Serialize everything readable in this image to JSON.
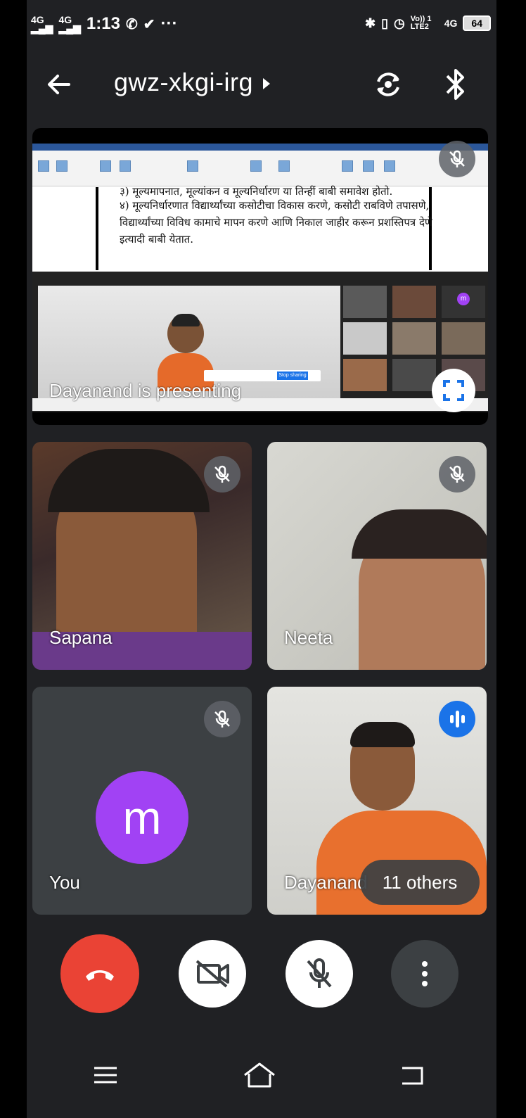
{
  "status_bar": {
    "time": "1:13",
    "network_left": "4G",
    "network_left2": "4G",
    "volte": "Vo)) 1 LTE2",
    "network_right": "4G",
    "battery": "64",
    "more": "···"
  },
  "header": {
    "meeting_code": "gwz-xkgi-irg"
  },
  "presentation": {
    "presenting_label": "Dayanand is presenting",
    "doc_lines": [
      "३) मूल्यमापनात, मूल्यांकन व मूल्यनिर्धारण या तिन्हीं बाबी समावेश होतो.",
      "४) मूल्यनिर्धारणात विद्यार्थ्यांच्या कसोटीचा विकास करणे, कसोटी राबविणे तपासणे,",
      "विद्यार्थ्यांच्या विविध कामाचे मापन करणे आणि निकाल जाहीर करून प्रशस्तिपत्र देणे",
      "इत्यादी बाबी येतात."
    ],
    "screenshare_banner_button": "Stop sharing"
  },
  "participants": [
    {
      "name": "Sapana",
      "muted": true
    },
    {
      "name": "Neeta",
      "muted": true
    },
    {
      "name": "You",
      "avatar_letter": "m",
      "muted": true,
      "avatar_color": "#a142f4"
    },
    {
      "name": "Dayanand",
      "speaking": true
    }
  ],
  "others_label": "11 others",
  "colors": {
    "end_call": "#ea4335",
    "speaking": "#1a73e8",
    "background": "#202124",
    "tile": "#3c4043"
  },
  "controls": [
    "end-call",
    "camera-off",
    "mic-off",
    "more-options"
  ],
  "nav": [
    "menu",
    "home",
    "back"
  ]
}
